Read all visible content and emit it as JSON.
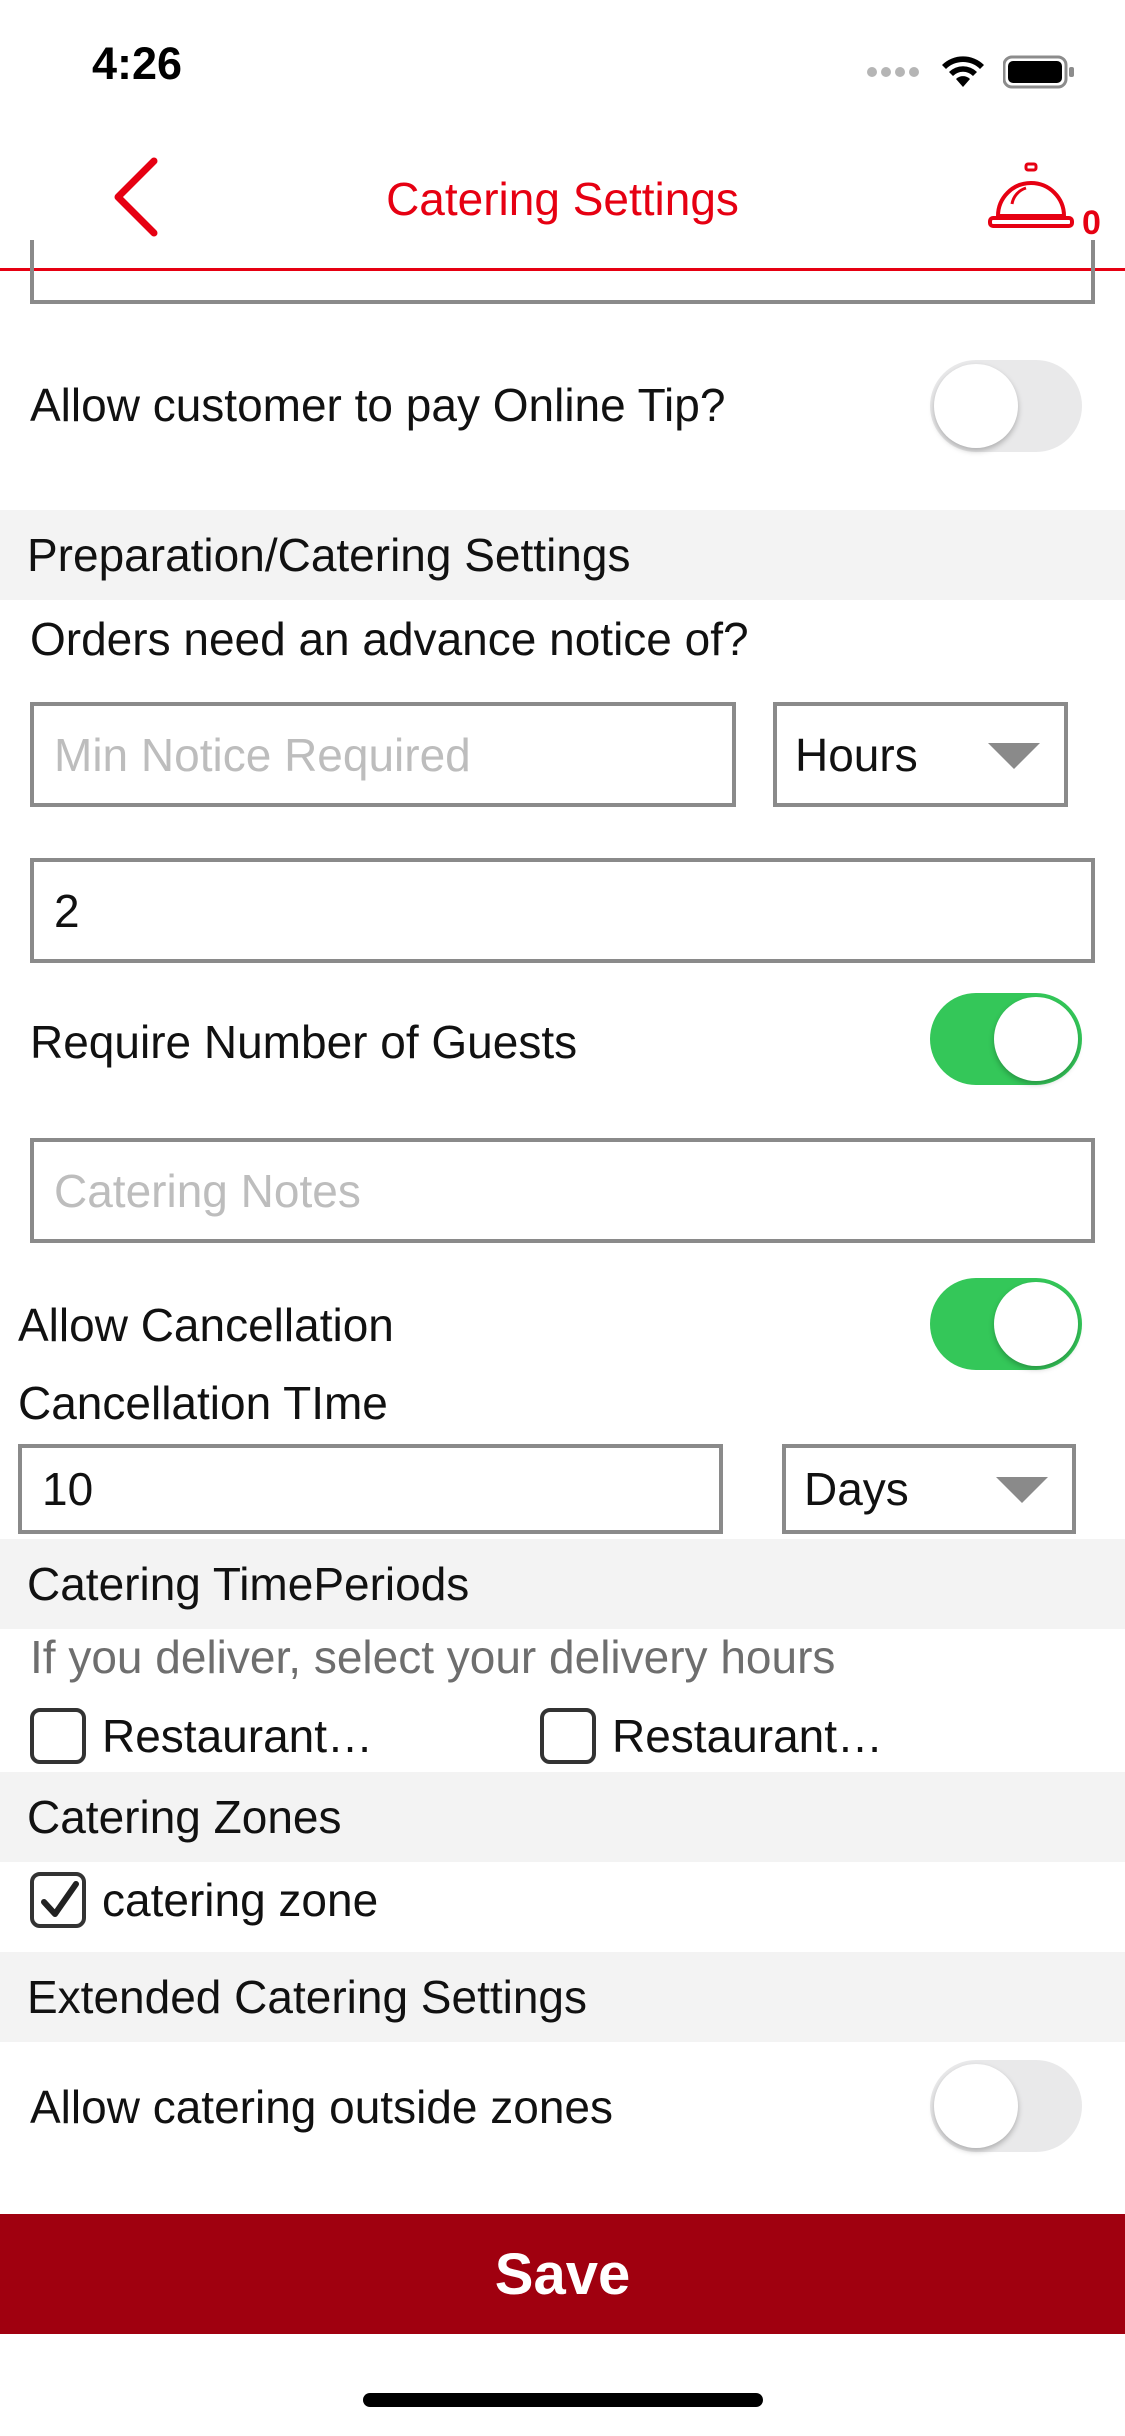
{
  "status_bar": {
    "time": "4:26"
  },
  "nav": {
    "title": "Catering Settings",
    "bell_count": "0"
  },
  "tip": {
    "label": "Allow customer to pay Online Tip?",
    "enabled": false
  },
  "prep_section": {
    "header": "Preparation/Catering Settings",
    "advance_label": "Orders need an advance notice of?",
    "min_notice_placeholder": "Min Notice Required",
    "notice_unit": "Hours",
    "notice_value": "2"
  },
  "guests": {
    "label": "Require Number of Guests",
    "enabled": true
  },
  "notes": {
    "placeholder": "Catering Notes"
  },
  "cancellation": {
    "label": "Allow Cancellation",
    "enabled": true,
    "time_label": "Cancellation TIme",
    "time_value": "10",
    "time_unit": "Days"
  },
  "time_periods": {
    "header": "Catering TimePeriods",
    "hint": "If you deliver, select your delivery hours",
    "options": [
      {
        "label": "Restaurant…",
        "checked": false
      },
      {
        "label": "Restaurant…",
        "checked": false
      }
    ]
  },
  "zones": {
    "header": "Catering Zones",
    "items": [
      {
        "label": "catering zone",
        "checked": true
      }
    ]
  },
  "extended": {
    "header": "Extended Catering Settings",
    "outside_label": "Allow catering outside zones",
    "outside_enabled": false
  },
  "save_label": "Save",
  "colors": {
    "brand_red": "#e60012",
    "save_bg": "#a0000f",
    "toggle_on": "#34c759",
    "toggle_off": "#e9e9ea"
  }
}
